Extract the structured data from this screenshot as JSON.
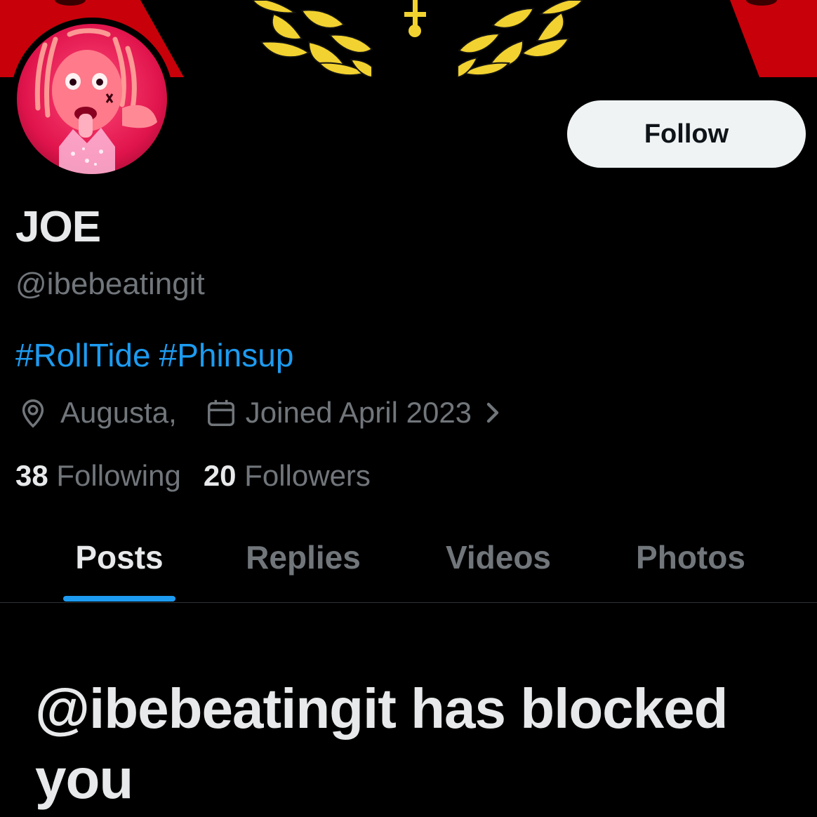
{
  "profile": {
    "display_name": "JOE",
    "handle": "@ibebeatingit",
    "bio_hashtags": [
      "#RollTide",
      "#Phinsup"
    ],
    "location": "Augusta,",
    "joined": "Joined April 2023",
    "following_count": "38",
    "following_label": "Following",
    "followers_count": "20",
    "followers_label": "Followers"
  },
  "actions": {
    "follow_label": "Follow"
  },
  "tabs": [
    {
      "label": "Posts",
      "active": true
    },
    {
      "label": "Replies",
      "active": false
    },
    {
      "label": "Videos",
      "active": false
    },
    {
      "label": "Photos",
      "active": false
    }
  ],
  "blocked_message": "@ibebeatingit has blocked you",
  "icons": {
    "location": "location-pin-icon",
    "calendar": "calendar-icon",
    "chevron": "chevron-right-icon"
  },
  "colors": {
    "background": "#000000",
    "accent": "#1d9bf0",
    "primary_text": "#e7e9ea",
    "secondary_text": "#71767b",
    "banner_red": "#c8000a",
    "banner_gold": "#f2d230",
    "follow_button_bg": "#eff3f4"
  }
}
